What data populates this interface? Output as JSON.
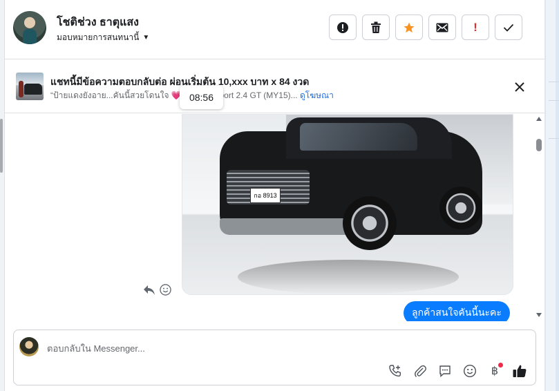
{
  "header": {
    "contact_name": "โชติช่วง ธาตุแสง",
    "assign_label": "มอบหมายการสนทนานี้",
    "tools": [
      {
        "icon": "alert-circle-icon",
        "glyph": "!"
      },
      {
        "icon": "trash-icon",
        "glyph": ""
      },
      {
        "icon": "star-icon",
        "glyph": "★"
      },
      {
        "icon": "envelope-icon",
        "glyph": "✉"
      },
      {
        "icon": "spam-icon",
        "glyph": "!"
      },
      {
        "icon": "check-icon",
        "glyph": "✓"
      }
    ],
    "colors": {
      "star": "#f7931e",
      "spam": "#e02d2d"
    }
  },
  "ad": {
    "title": "แชทนี้มีข้อความตอบกลับต่อ ผ่อนเริ่มต้น 10,xxx บาท x 84 งวด",
    "subtitle_start": "“ป้ายแดงยังอาย...คันนี้สวยโดนใจ",
    "heart": "💗",
    "subtitle_end": "Sport 2.4 GT (MY15)...",
    "link": "ดูโฆษณา",
    "timestamp_tooltip": "08:56"
  },
  "thread": {
    "car_plate": "กอ 8913",
    "message_out": "ลูกค้าสนใจคันนี้นะคะ"
  },
  "composer": {
    "placeholder": "ตอบกลับใน Messenger...",
    "actions": [
      "phone-plus-icon",
      "paperclip-icon",
      "saved-reply-icon",
      "emoji-icon",
      "baht-payment-icon",
      "thumbs-up-icon"
    ],
    "accent": "#0a7cff"
  }
}
